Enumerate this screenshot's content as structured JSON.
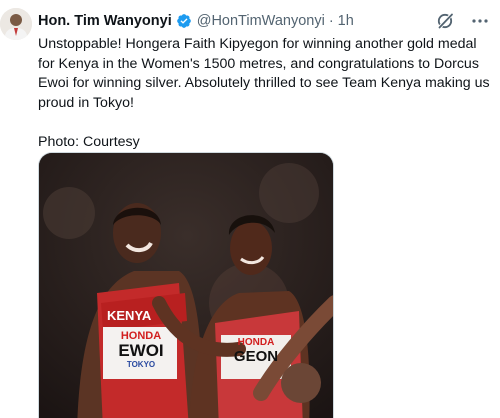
{
  "tweet": {
    "author_name": "Hon. Tim Wanyonyi",
    "handle": "@HonTimWanyonyi",
    "separator": "·",
    "time": "1h",
    "text": "Unstoppable! Hongera Faith Kipyegon for winning another gold medal for Kenya in the Women's 1500 metres, and congratulations to Dorcus Ewoi for winning silver. Absolutely thrilled to see Team Kenya making us proud in Tokyo!\n\nPhoto: Courtesy",
    "photo": {
      "bib_left_line1": "KENYA",
      "bib_left_line2": "HONDA",
      "bib_left_name": "EWOI",
      "bib_left_place": "TOKYO",
      "bib_right_line1": "HONDA",
      "bib_right_name": "GEON"
    }
  },
  "icons": {
    "verified": "verified-badge-icon",
    "grok": "grok-icon",
    "more": "more-icon"
  },
  "colors": {
    "verified_blue": "#1d9bf0",
    "secondary_text": "#536471"
  }
}
